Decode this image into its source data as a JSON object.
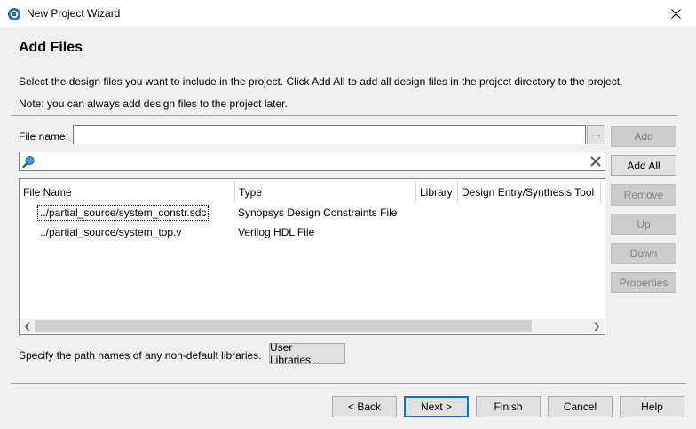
{
  "window": {
    "title": "New Project Wizard"
  },
  "page": {
    "title": "Add Files",
    "description": "Select the design files you want to include in the project. Click Add All to add all design files in the project directory to the project.",
    "note": "Note: you can always add design files to the project later."
  },
  "file_name": {
    "label": "File name:",
    "value": "",
    "browse_label": "..."
  },
  "search": {
    "value": ""
  },
  "table": {
    "columns": [
      "File Name",
      "Type",
      "Library",
      "Design Entry/Synthesis Tool"
    ],
    "rows": [
      {
        "file": "../partial_source/system_constr.sdc",
        "type": "Synopsys Design Constraints File",
        "library": "",
        "tool": ""
      },
      {
        "file": "../partial_source/system_top.v",
        "type": "Verilog HDL File",
        "library": "",
        "tool": ""
      }
    ]
  },
  "side_buttons": {
    "add": "Add",
    "add_all": "Add All",
    "remove": "Remove",
    "up": "Up",
    "down": "Down",
    "properties": "Properties"
  },
  "libraries": {
    "text": "Specify the path names of any non-default libraries.",
    "button": "User Libraries..."
  },
  "footer": {
    "back": "< Back",
    "next": "Next >",
    "finish": "Finish",
    "cancel": "Cancel",
    "help": "Help"
  },
  "colors": {
    "accent": "#0078d7",
    "disabled_text": "#838383"
  }
}
